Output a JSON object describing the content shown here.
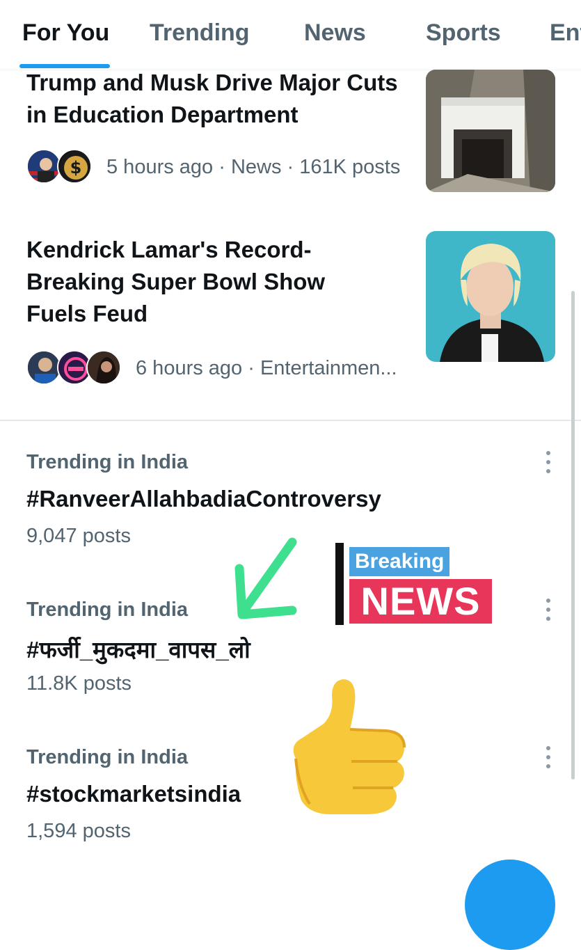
{
  "tabs": [
    {
      "label": "For You",
      "active": true
    },
    {
      "label": "Trending",
      "active": false
    },
    {
      "label": "News",
      "active": false
    },
    {
      "label": "Sports",
      "active": false
    },
    {
      "label": "Ent",
      "active": false
    }
  ],
  "news": [
    {
      "headline": "Trump and Musk Drive Major Cuts in Education Department",
      "meta": "5 hours ago · News · 161K posts",
      "thumbnail_icon": "tunnel-entrance-image"
    },
    {
      "headline": "Kendrick Lamar's Record-Breaking Super Bowl Show Fuels Feud",
      "meta": "6 hours ago · Entertainmen...",
      "thumbnail_icon": "person-portrait-image"
    }
  ],
  "trends": [
    {
      "context": "Trending in India",
      "title": "#RanveerAllahbadiaControversy",
      "count": "9,047 posts"
    },
    {
      "context": "Trending in India",
      "title": "#फर्जी_मुकदमा_वापस_लो",
      "count": "11.8K posts"
    },
    {
      "context": "Trending in India",
      "title": "#stockmarketsindia",
      "count": "1,594 posts"
    }
  ],
  "overlay": {
    "breaking_word": "Breaking",
    "news_word": "NEWS"
  },
  "colors": {
    "accent": "#1d9bf0",
    "text_primary": "#0f1419",
    "text_secondary": "#536471",
    "arrow_green": "#3ee08f",
    "breaking_blue": "#4aa3e0",
    "news_red": "#e8365a"
  }
}
